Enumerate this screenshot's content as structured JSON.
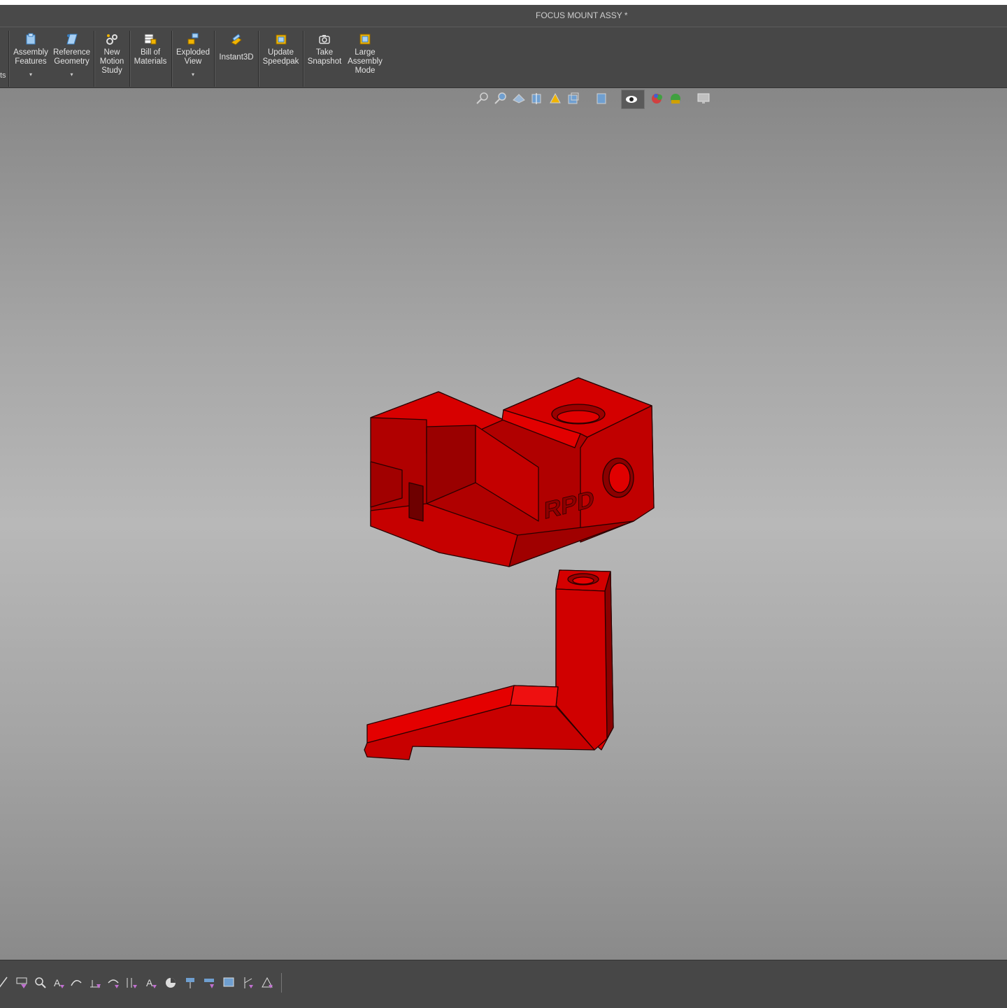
{
  "window": {
    "title": "FOCUS MOUNT ASSY *"
  },
  "ribbon": {
    "clipped_label": "ts",
    "buttons": [
      {
        "label": "Assembly\nFeatures",
        "icon": "assembly-features-icon",
        "has_dropdown": true
      },
      {
        "label": "Reference\nGeometry",
        "icon": "reference-geometry-icon",
        "has_dropdown": true
      },
      {
        "label": "New\nMotion\nStudy",
        "icon": "motion-study-icon",
        "has_dropdown": false
      },
      {
        "label": "Bill of\nMaterials",
        "icon": "bill-of-materials-icon",
        "has_dropdown": false
      },
      {
        "label": "Exploded\nView",
        "icon": "exploded-view-icon",
        "has_dropdown": true
      },
      {
        "label": "Instant3D",
        "icon": "instant3d-icon",
        "has_dropdown": false
      },
      {
        "label": "Update\nSpeedpak",
        "icon": "speedpak-icon",
        "has_dropdown": false
      },
      {
        "label": "Take\nSnapshot",
        "icon": "camera-icon",
        "has_dropdown": false
      },
      {
        "label": "Large\nAssembly\nMode",
        "icon": "large-assembly-icon",
        "has_dropdown": false
      }
    ],
    "dropdown_glyph": "▾"
  },
  "heads_up_toolbar": [
    "zoom-to-fit-icon",
    "zoom-to-area-icon",
    "previous-view-icon",
    "section-view-icon",
    "dynamic-annotation-icon",
    "view-orientation-icon",
    "display-style-icon",
    "hide-show-items-icon",
    "edit-appearance-icon",
    "apply-scene-icon",
    "view-settings-icon"
  ],
  "model": {
    "part_color": "#cc0000",
    "part_edge_color": "#2a0000",
    "engraved_text": "RPD"
  },
  "bottom_toolbar": [
    "smart-dimension-icon",
    "model-items-icon",
    "spell-checker-icon",
    "note-icon",
    "balloon-icon",
    "auto-balloon-icon",
    "surface-finish-icon",
    "weld-symbol-icon",
    "datum-feature-icon",
    "datum-target-icon",
    "geometric-tolerance-icon",
    "center-mark-icon",
    "centerline-icon",
    "hole-callout-icon",
    "revision-symbol-icon",
    "area-hatch-icon"
  ]
}
